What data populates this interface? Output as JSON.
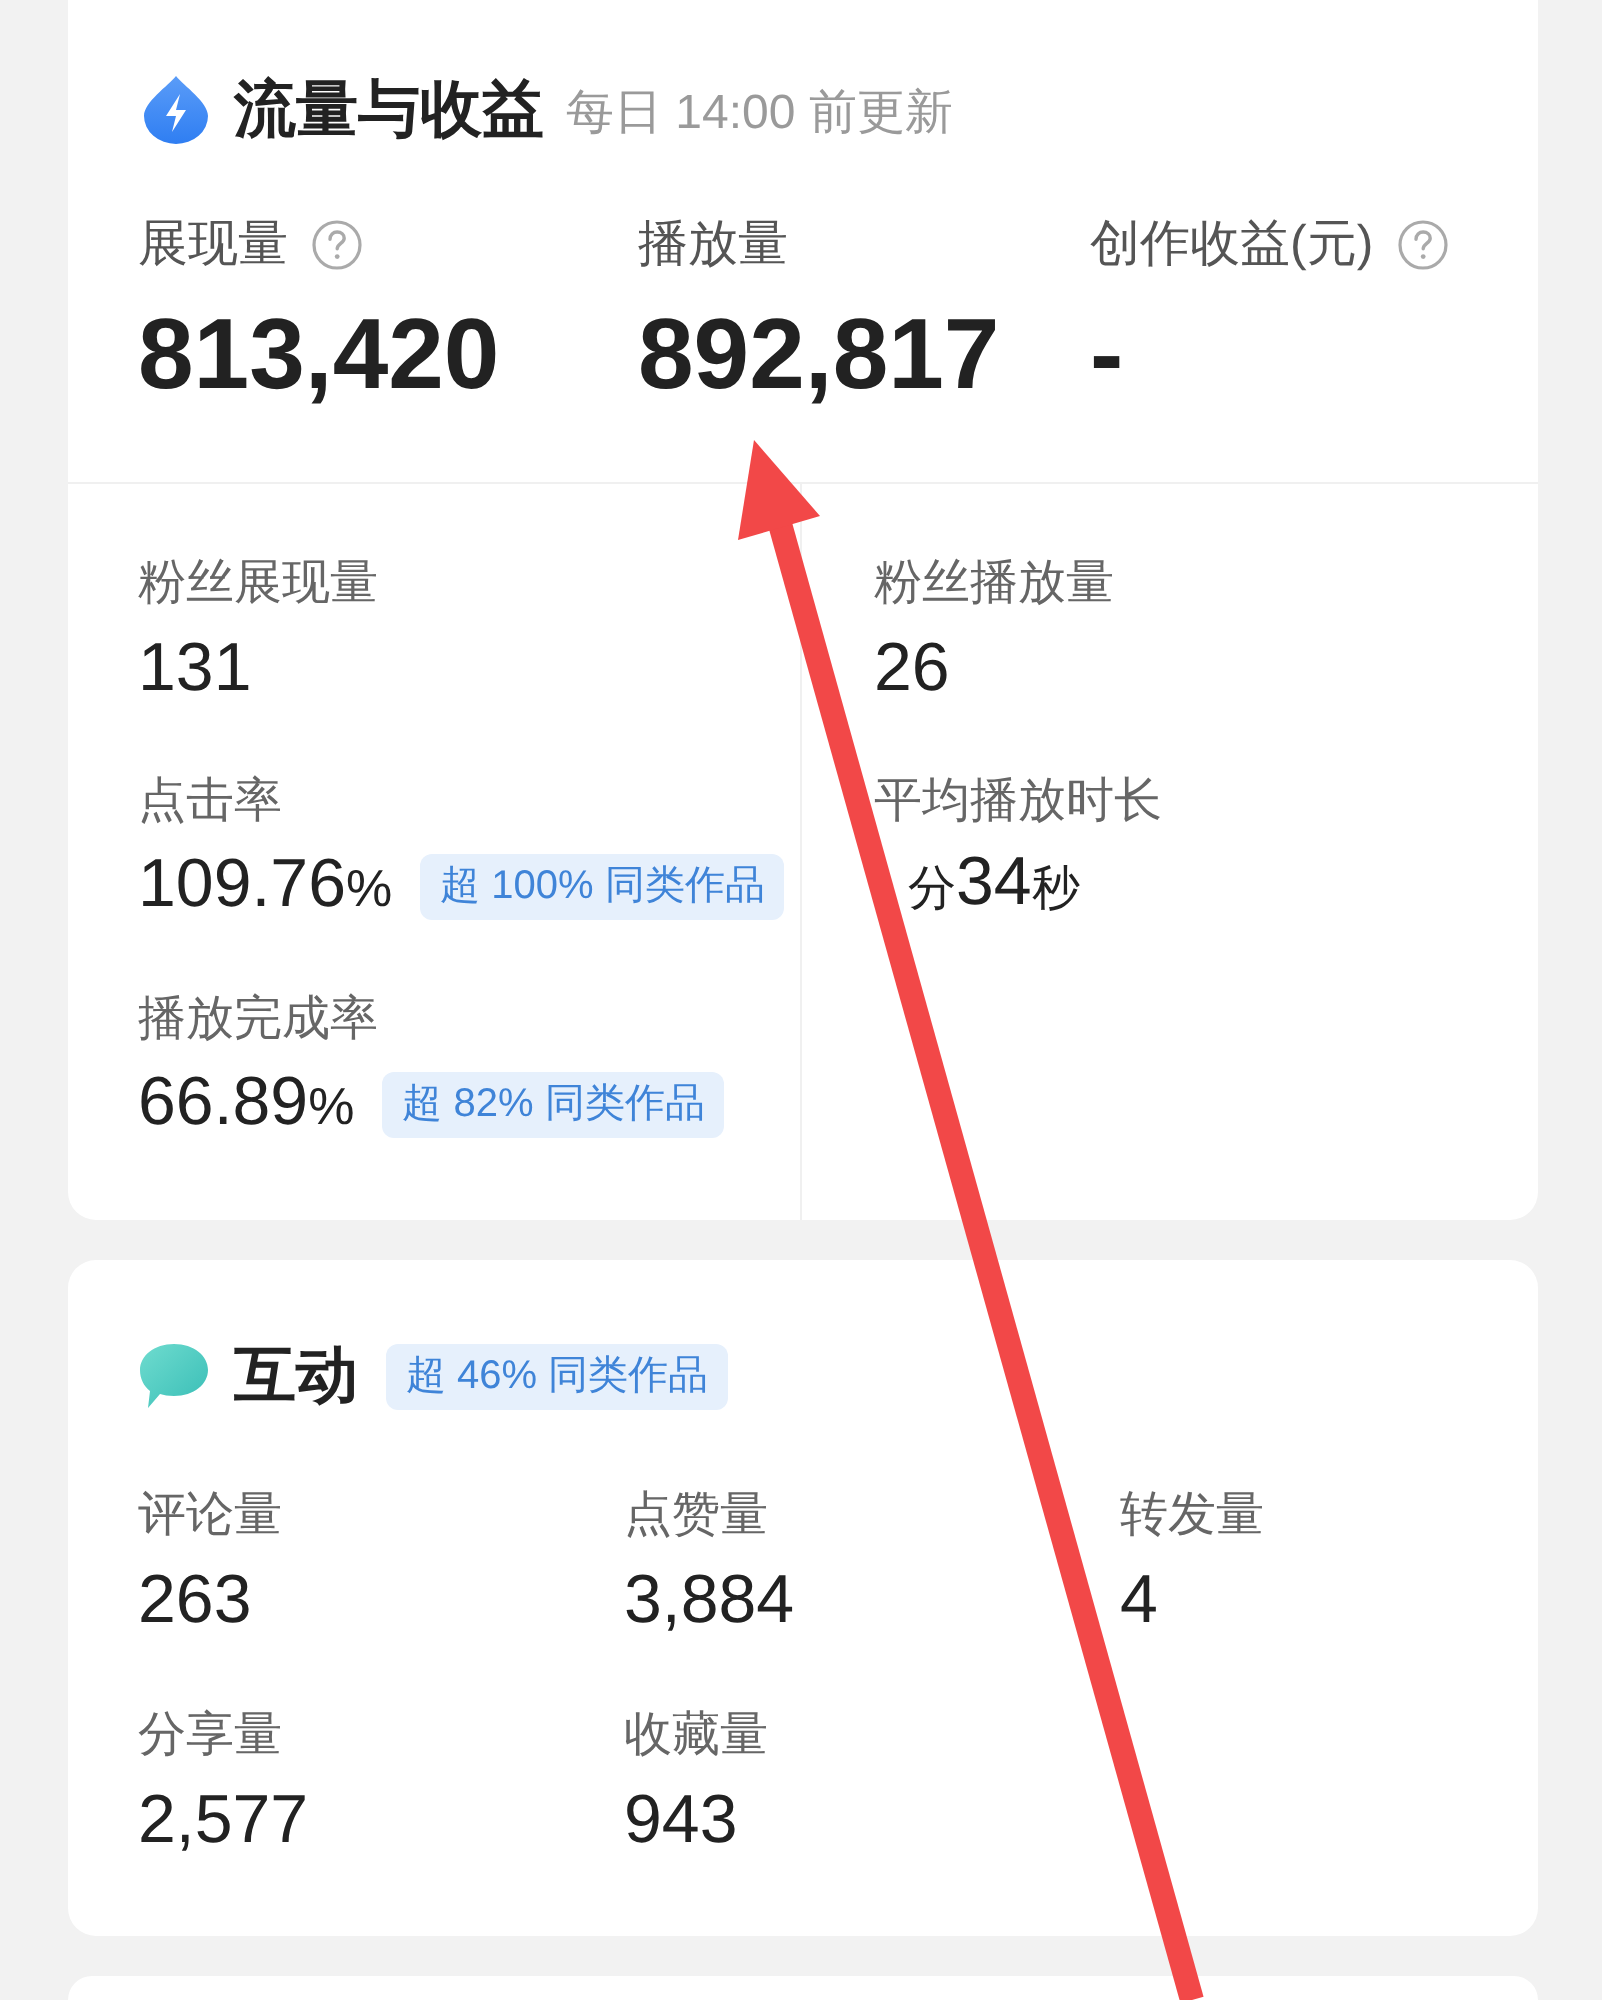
{
  "traffic": {
    "title": "流量与收益",
    "subtitle": "每日 14:00 前更新",
    "metrics": [
      {
        "label": "展现量",
        "help": true,
        "value": "813,420"
      },
      {
        "label": "播放量",
        "help": false,
        "value": "892,817"
      },
      {
        "label": "创作收益(元)",
        "help": true,
        "value": "-"
      }
    ],
    "detail_columns": [
      [
        {
          "label": "粉丝展现量",
          "value": [
            {
              "kind": "number",
              "text": "131"
            }
          ]
        },
        {
          "label": "点击率",
          "value": [
            {
              "kind": "number",
              "text": "109.76"
            },
            {
              "kind": "unit",
              "text": "%"
            }
          ],
          "badge": "超 100% 同类作品"
        },
        {
          "label": "播放完成率",
          "value": [
            {
              "kind": "number",
              "text": "66.89"
            },
            {
              "kind": "unit",
              "text": "%"
            }
          ],
          "badge": "超 82% 同类作品"
        }
      ],
      [
        {
          "label": "粉丝播放量",
          "value": [
            {
              "kind": "number",
              "text": "26"
            }
          ]
        },
        {
          "label": "平均播放时长",
          "value": [
            {
              "kind": "unit",
              "text": "分"
            },
            {
              "kind": "number",
              "text": "34"
            },
            {
              "kind": "unit",
              "text": "秒"
            }
          ]
        }
      ]
    ]
  },
  "interaction": {
    "title": "互动",
    "badge": "超 46% 同类作品",
    "metrics": [
      {
        "label": "评论量",
        "value": "263"
      },
      {
        "label": "点赞量",
        "value": "3,884"
      },
      {
        "label": "转发量",
        "value": "4"
      },
      {
        "label": "分享量",
        "value": "2,577"
      },
      {
        "label": "收藏量",
        "value": "943"
      }
    ]
  },
  "annotations": [
    {
      "kind": "arrow"
    }
  ]
}
